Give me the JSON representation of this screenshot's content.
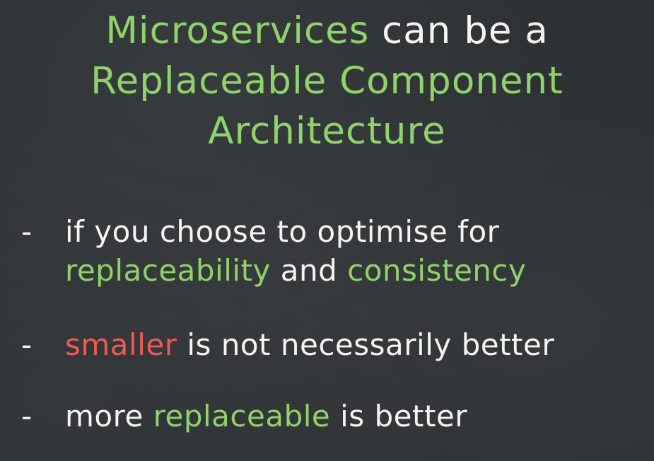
{
  "slide": {
    "title": {
      "line1": {
        "green": "Microservices",
        "white": " can be a"
      },
      "line2": {
        "green": "Replaceable Component"
      },
      "line3": {
        "green": "Architecture"
      }
    },
    "bullets": [
      {
        "dash": "-",
        "line1": {
          "white": "if you choose to optimise for"
        },
        "line2": {
          "green1": "replaceability",
          "white": " and ",
          "green2": "consistency"
        }
      },
      {
        "dash": "-",
        "red": "smaller",
        "white": " is not necessarily better"
      },
      {
        "dash": "-",
        "white1": "more ",
        "green": "replaceable",
        "white2": " is better"
      }
    ],
    "colors": {
      "background": "#2d3134",
      "green": "#8fd36a",
      "white": "#f4f4f0",
      "red": "#ef5a55"
    }
  }
}
